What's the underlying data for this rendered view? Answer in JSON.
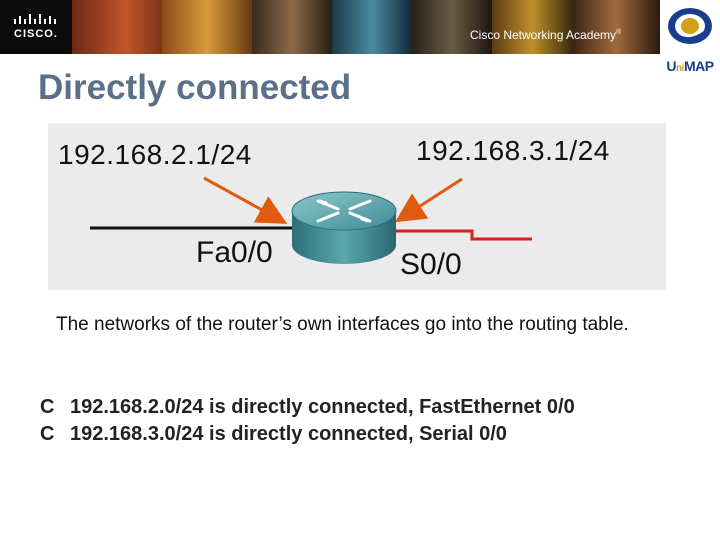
{
  "header": {
    "brand_word": "CISCO.",
    "academy_text": "Cisco Networking Academy",
    "academy_mark": "®",
    "partner_logo_text": "UniMAP"
  },
  "slide": {
    "title": "Directly connected",
    "description": "The networks of the router’s own interfaces go into the routing table."
  },
  "diagram": {
    "left_ip": "192.168.2.1/24",
    "right_ip": "192.168.3.1/24",
    "left_interface": "Fa0/0",
    "right_interface": "S0/0",
    "colors": {
      "ethernet_link": "#111111",
      "serial_link": "#d81e1e",
      "arrow": "#e05a10",
      "router": "#4a9aa0"
    }
  },
  "routing_table": [
    {
      "code": "C",
      "text": "192.168.2.0/24 is directly connected, FastEthernet 0/0"
    },
    {
      "code": "C",
      "text": "192.168.3.0/24 is directly connected, Serial 0/0"
    }
  ]
}
